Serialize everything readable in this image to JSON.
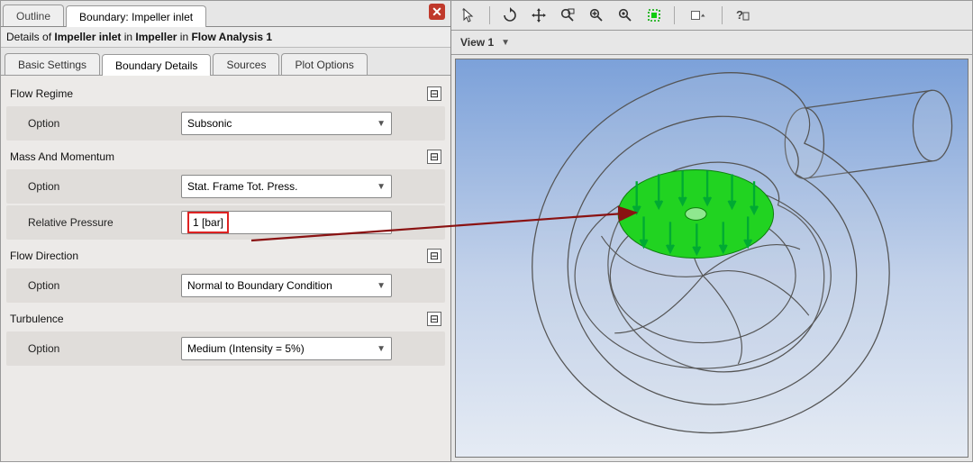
{
  "left": {
    "top_tabs": {
      "outline": "Outline",
      "boundary": "Boundary: Impeller inlet"
    },
    "details": {
      "prefix": "Details of ",
      "b1": "Impeller inlet",
      "mid": " in ",
      "b2": "Impeller",
      "mid2": " in ",
      "b3": "Flow Analysis 1"
    },
    "sub_tabs": {
      "basic": "Basic Settings",
      "boundary": "Boundary Details",
      "sources": "Sources",
      "plot": "Plot Options"
    },
    "groups": {
      "flow_regime": {
        "title": "Flow Regime",
        "option_label": "Option",
        "option_value": "Subsonic",
        "collapse": "⊟"
      },
      "mass_momentum": {
        "title": "Mass And Momentum",
        "option_label": "Option",
        "option_value": "Stat. Frame Tot. Press.",
        "relpress_label": "Relative Pressure",
        "relpress_value": "1 [bar]",
        "collapse": "⊟"
      },
      "flow_direction": {
        "title": "Flow Direction",
        "option_label": "Option",
        "option_value": "Normal to Boundary Condition",
        "collapse": "⊟"
      },
      "turbulence": {
        "title": "Turbulence",
        "option_label": "Option",
        "option_value": "Medium (Intensity = 5%)",
        "collapse": "⊟"
      }
    }
  },
  "right": {
    "view_label": "View 1"
  }
}
